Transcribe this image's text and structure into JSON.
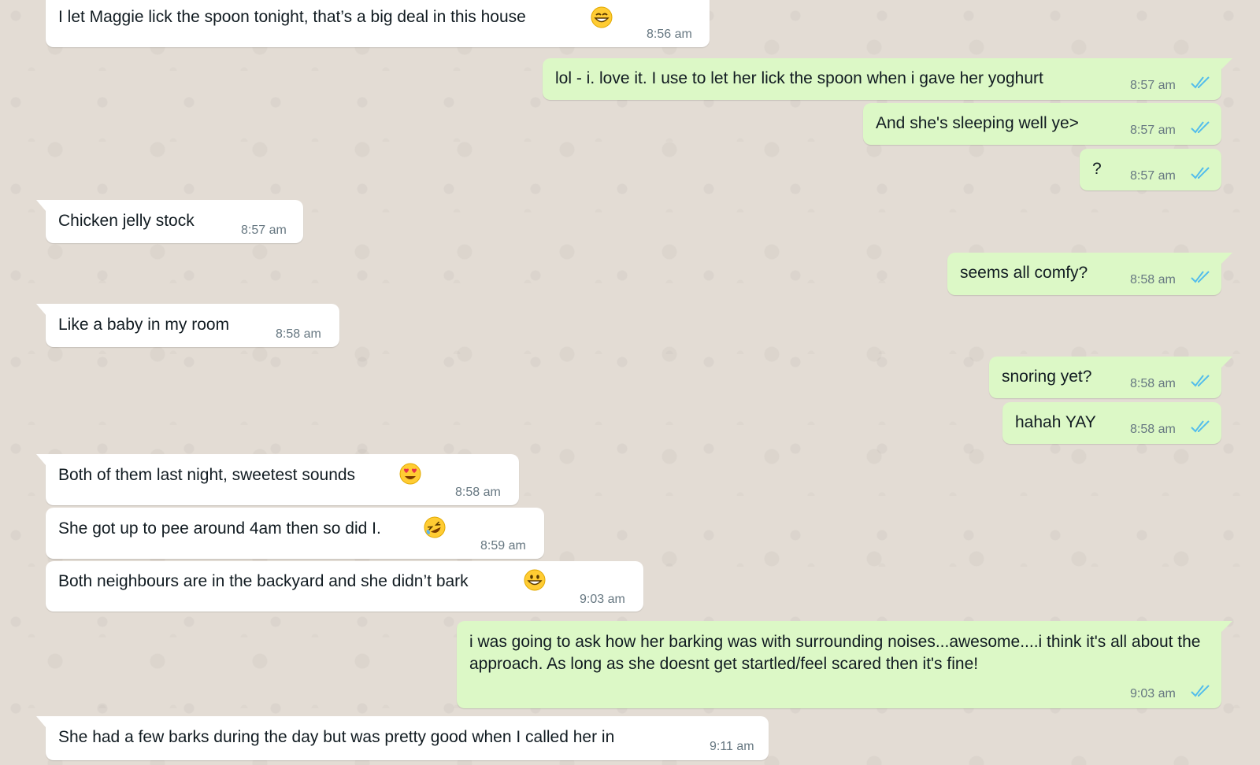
{
  "colors": {
    "incoming_bubble": "#ffffff",
    "outgoing_bubble": "#dcf8c6",
    "read_tick": "#53bdeb",
    "time_text": "#667781",
    "wallpaper": "#e3dcd4"
  },
  "messages": [
    {
      "dir": "in",
      "text": "I let Maggie lick the spoon tonight, that’s a big deal in this house",
      "emoji": "grinning-face-with-smiling-eyes",
      "time": "8:56 am"
    },
    {
      "dir": "out",
      "text": "lol - i. love it. I use to let her lick the spoon when i gave her yoghurt",
      "time": "8:57 am",
      "status": "read"
    },
    {
      "dir": "out",
      "text": "And she's sleeping well ye>",
      "time": "8:57 am",
      "status": "read"
    },
    {
      "dir": "out",
      "text": "?",
      "time": "8:57 am",
      "status": "read"
    },
    {
      "dir": "in",
      "text": "Chicken jelly stock",
      "time": "8:57 am"
    },
    {
      "dir": "out",
      "text": "seems all comfy?",
      "time": "8:58 am",
      "status": "read"
    },
    {
      "dir": "in",
      "text": "Like a baby in my room",
      "time": "8:58 am"
    },
    {
      "dir": "out",
      "text": "snoring yet?",
      "time": "8:58 am",
      "status": "read"
    },
    {
      "dir": "out",
      "text": "hahah YAY",
      "time": "8:58 am",
      "status": "read"
    },
    {
      "dir": "in",
      "text": "Both of them last night, sweetest sounds",
      "emoji": "heart-eyes-face",
      "time": "8:58 am"
    },
    {
      "dir": "in",
      "text": "She got up to pee around 4am then so did I.",
      "emoji": "rolling-on-floor-laughing-face",
      "time": "8:59 am"
    },
    {
      "dir": "in",
      "text": "Both neighbours are in the backyard and she didn’t bark",
      "emoji": "grinning-face",
      "time": "9:03 am"
    },
    {
      "dir": "out",
      "text": "i was going to ask how her barking was with surrounding noises...awesome....i think it's all about the approach. As long as she doesnt get startled/feel scared then it's fine!",
      "time": "9:03 am",
      "status": "read"
    },
    {
      "dir": "in",
      "text": "She had a few barks during the day but was pretty good when I called her in",
      "time": "9:11 am"
    }
  ]
}
